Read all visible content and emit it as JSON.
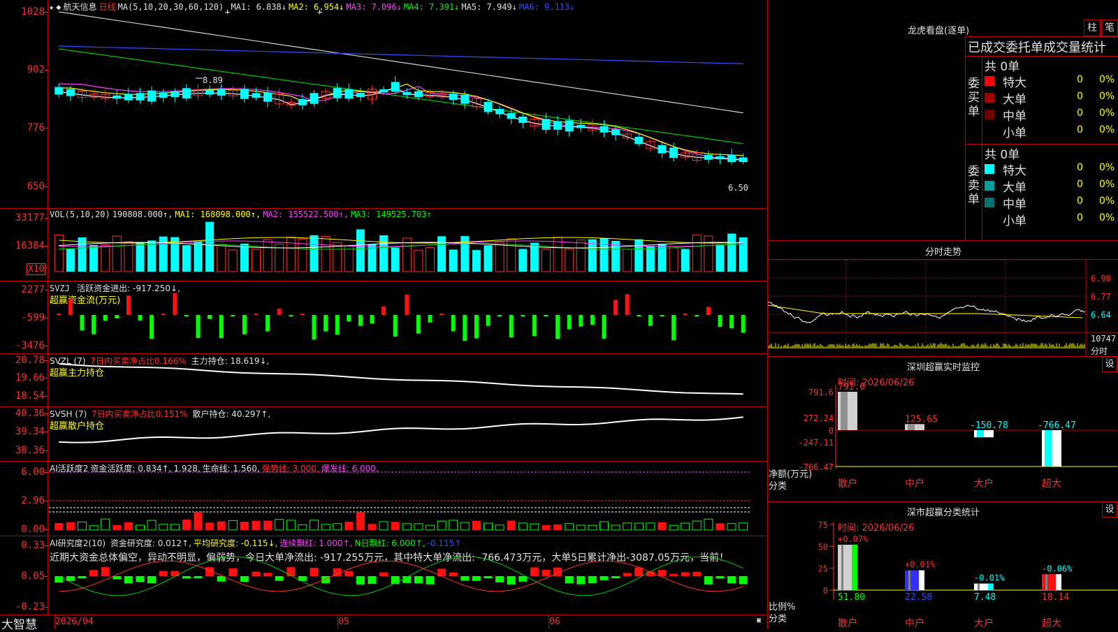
{
  "header": {
    "stock_name": "航天信息",
    "period": "日线",
    "ma_param": "MA(5,10,20,30,60,120)",
    "ma1": "MA1: 6.838↓",
    "ma2": "MA2: 6.954↓",
    "ma3": "MA3: 7.096↓",
    "ma4": "MA4: 7.391↓",
    "ma5": "MA5: 7.949↓",
    "ma6": "MA6: 9.113↓",
    "price_high_label": "8.89",
    "price_low_label": "6.50"
  },
  "price_axis": [
    "1028",
    "902",
    "776",
    "650"
  ],
  "vol": {
    "title": "VOL(5,10,20)",
    "value": "190808.000↑,",
    "ma1": "MA1: 168098.000↑,",
    "ma2": "MA2: 155522.500↑,",
    "ma3": "MA3: 149525.703↑",
    "axis": [
      "33177",
      "16384"
    ],
    "unit": "X10"
  },
  "svzj": {
    "title": "SVZJ",
    "label": "活跃资金进出: -917.250↓,",
    "sub": "超赢资金流(万元)",
    "axis": [
      "2277",
      "-599",
      "-3476"
    ]
  },
  "svzl": {
    "title": "SVZL (7)",
    "label1": "7日内买卖净占比0.166%",
    "label2": "主力持仓: 18.619↓,",
    "sub": "超赢主力持仓",
    "axis": [
      "20.78",
      "19.66",
      "18.54"
    ]
  },
  "svsh": {
    "title": "SVSH (7)",
    "label1": "7日内买卖净占比0.151%",
    "label2": "散户持仓: 40.297↑,",
    "sub": "超赢散户持仓",
    "axis": [
      "40.36",
      "39.34",
      "38.36"
    ]
  },
  "ai1": {
    "title": "AI活跃度2",
    "label1": "资金活跃度: 0.834↑,",
    "label2": "1.928,",
    "label3": "生命线: 1.560,",
    "label4": "强势线: 3.000,",
    "label5": "爆发线: 6.000,",
    "axis": [
      "6.00",
      "2.96",
      "0.00"
    ]
  },
  "ai2": {
    "title": "AI研究度2(10)",
    "label1": "资金研究度: 0.012↑,",
    "label2": "平均研究度: -0.115↓,",
    "label3": "连续飘红: 1.000↑,",
    "label4": "N日飘红: 6.000↑,",
    "label5": "-0.115↑",
    "comment": "近期大资金总体偏空，异动不明显，偏弱势，今日大单净流出: -917.255万元，其中特大单净流出: -766.473万元，大单5日累计净出-3087.05万元，当前！",
    "axis": [
      "0.33",
      "0.05",
      "-0.23"
    ]
  },
  "bottom_bar": {
    "brand": "大智慧",
    "date_start": "2026/04",
    "month1": "05",
    "month2": "06"
  },
  "lhb": {
    "title": "龙虎看盘(逐单)",
    "btn_zhu": "柱",
    "btn_bi": "笔",
    "subtitle": "已成交委托单成交量统计",
    "buy_side": "委买单",
    "sell_side": "委卖单",
    "buy_total": "共 0单",
    "sell_total": "共 0单",
    "buy_rows": [
      {
        "label": "特大",
        "count": "0",
        "pct": "0%",
        "color": "#ff0000"
      },
      {
        "label": "大单",
        "count": "0",
        "pct": "0%",
        "color": "#a00000"
      },
      {
        "label": "中单",
        "count": "0",
        "pct": "0%",
        "color": "#700000"
      },
      {
        "label": "小单",
        "count": "0",
        "pct": "0%",
        "color": ""
      }
    ],
    "sell_rows": [
      {
        "label": "特大",
        "count": "0",
        "pct": "0%",
        "color": "#00ffff"
      },
      {
        "label": "大单",
        "count": "0",
        "pct": "0%",
        "color": "#00a0a0"
      },
      {
        "label": "中单",
        "count": "0",
        "pct": "0%",
        "color": "#007070"
      },
      {
        "label": "小单",
        "count": "0",
        "pct": "0%",
        "color": ""
      }
    ]
  },
  "intraday": {
    "title": "分时走势",
    "axis": [
      "6.90",
      "6.77",
      "6.64"
    ],
    "vol_label": "10747",
    "unit": "分时"
  },
  "sz_monitor": {
    "title": "深圳超赢实时监控",
    "set": "设",
    "time": "时间: 2026/06/26",
    "axis": [
      "791.6",
      "272.24",
      "0",
      "-247.11",
      "-766.47"
    ],
    "ylabel": "净额(万元)",
    "xlabel": "分类",
    "bars": [
      {
        "name": "散户",
        "value": "791.6"
      },
      {
        "name": "中户",
        "value": "125.65"
      },
      {
        "name": "大户",
        "value": "-150.78"
      },
      {
        "name": "超大",
        "value": "-766.47"
      }
    ]
  },
  "sz_stats": {
    "title": "深市超赢分类统计",
    "set": "设",
    "time": "时间: 2026/06/26",
    "axis": [
      "75",
      "50",
      "25",
      "0"
    ],
    "ylabel": "比例%",
    "xlabel": "分类",
    "bars": [
      {
        "name": "散户",
        "value": "51.80",
        "delta": "+0.07%"
      },
      {
        "name": "中户",
        "value": "22.58",
        "delta": "+0.01%"
      },
      {
        "name": "大户",
        "value": "7.48",
        "delta": "-0.01%"
      },
      {
        "name": "超大",
        "value": "18.14",
        "delta": "-0.06%"
      }
    ]
  }
}
